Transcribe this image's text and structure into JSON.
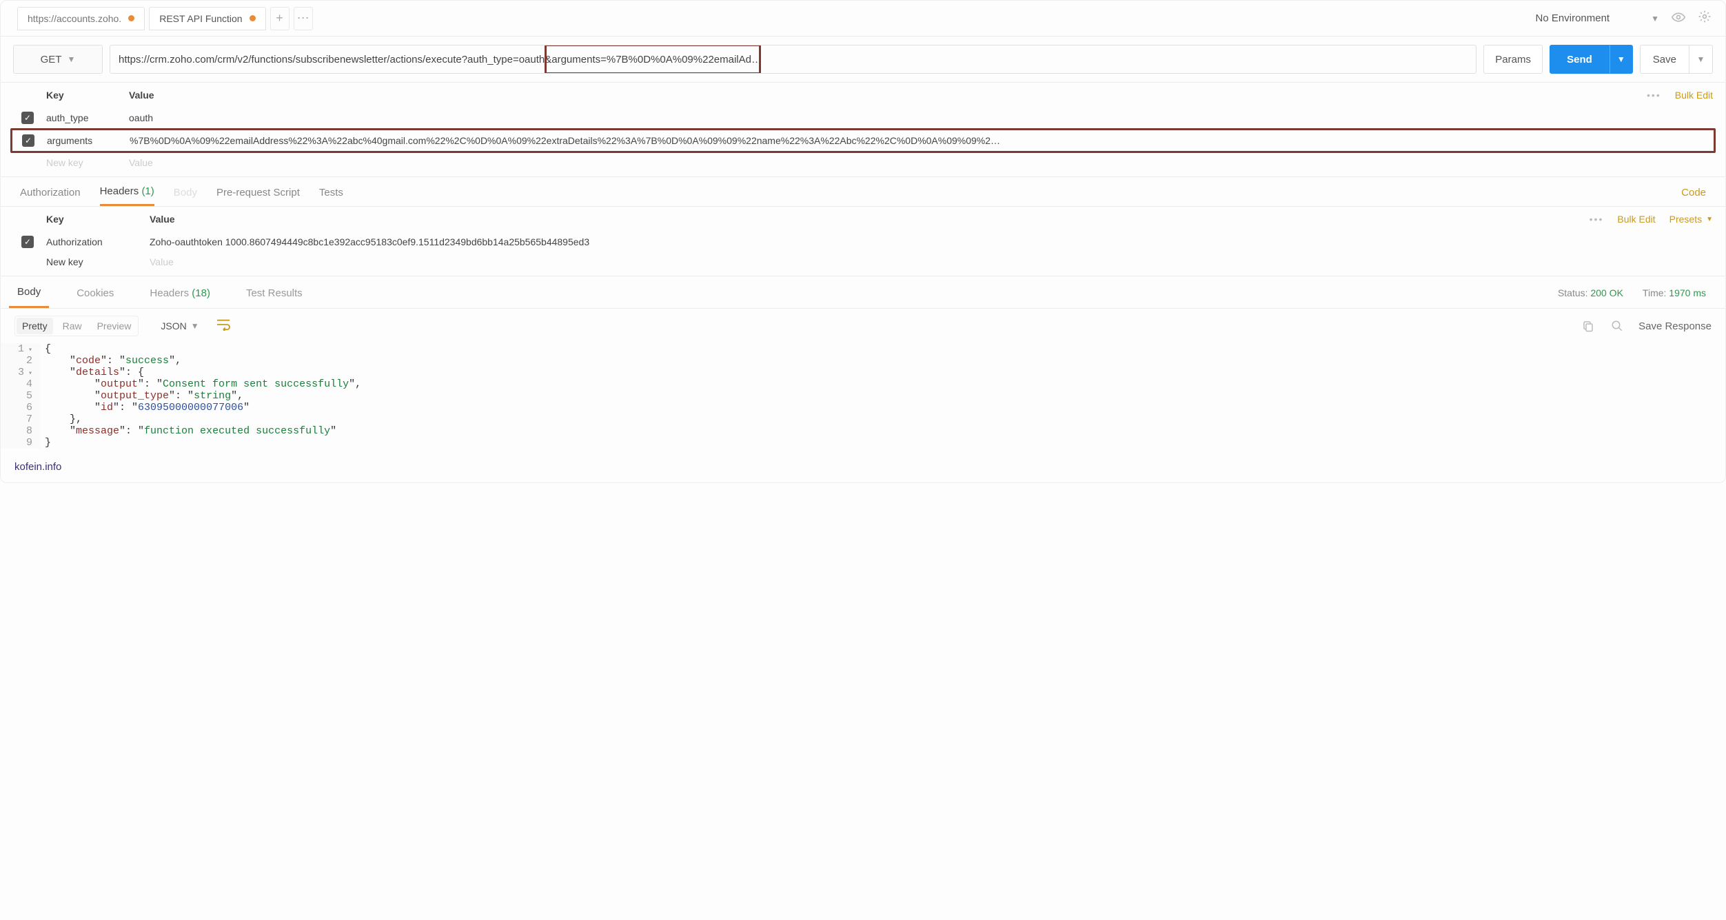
{
  "env": {
    "label": "No Environment"
  },
  "tabs": [
    {
      "label": "https://accounts.zoho."
    },
    {
      "label": "REST API Function"
    }
  ],
  "request": {
    "method": "GET",
    "url": "https://crm.zoho.com/crm/v2/functions/subscribenewsletter/actions/execute?auth_type=oauth&arguments=%7B%0D%0A%09%22emailAd…",
    "params_btn": "Params",
    "send_btn": "Send",
    "save_btn": "Save"
  },
  "params_table": {
    "key_header": "Key",
    "value_header": "Value",
    "bulk_edit": "Bulk Edit",
    "rows": [
      {
        "key": "auth_type",
        "value": "oauth"
      },
      {
        "key": "arguments",
        "value": "%7B%0D%0A%09%22emailAddress%22%3A%22abc%40gmail.com%22%2C%0D%0A%09%22extraDetails%22%3A%7B%0D%0A%09%09%22name%22%3A%22Abc%22%2C%0D%0A%09%09%2…"
      }
    ],
    "new_key": "New key",
    "new_value": "Value"
  },
  "req_section_tabs": {
    "authorization": "Authorization",
    "headers": "Headers",
    "headers_count": "(1)",
    "body": "Body",
    "prerequest": "Pre-request Script",
    "tests": "Tests",
    "code": "Code"
  },
  "headers_table": {
    "key_header": "Key",
    "value_header": "Value",
    "bulk_edit": "Bulk Edit",
    "presets": "Presets",
    "rows": [
      {
        "key": "Authorization",
        "value": "Zoho-oauthtoken 1000.8607494449c8bc1e392acc95183c0ef9.1511d2349bd6bb14a25b565b44895ed3"
      }
    ],
    "new_key": "New key",
    "new_value": "Value"
  },
  "resp_tabs": {
    "body": "Body",
    "cookies": "Cookies",
    "headers": "Headers",
    "headers_count": "(18)",
    "tests": "Test Results"
  },
  "resp_meta": {
    "status_label": "Status:",
    "status_value": "200 OK",
    "time_label": "Time:",
    "time_value": "1970 ms"
  },
  "resp_toolbar": {
    "pretty": "Pretty",
    "raw": "Raw",
    "preview": "Preview",
    "json": "JSON",
    "save_response": "Save Response"
  },
  "response_body": {
    "l1": "{",
    "l2a": "    \"",
    "l2k": "code",
    "l2b": "\": \"",
    "l2v": "success",
    "l2c": "\",",
    "l3a": "    \"",
    "l3k": "details",
    "l3b": "\": {",
    "l4a": "        \"",
    "l4k": "output",
    "l4b": "\": \"",
    "l4v": "Consent form sent successfully",
    "l4c": "\",",
    "l5a": "        \"",
    "l5k": "output_type",
    "l5b": "\": \"",
    "l5v": "string",
    "l5c": "\",",
    "l6a": "        \"",
    "l6k": "id",
    "l6b": "\": \"",
    "l6v": "63095000000077006",
    "l6c": "\"",
    "l7": "    },",
    "l8a": "    \"",
    "l8k": "message",
    "l8b": "\": \"",
    "l8v": "function executed successfully",
    "l8c": "\"",
    "l9": "}"
  },
  "footer": "kofein.info"
}
